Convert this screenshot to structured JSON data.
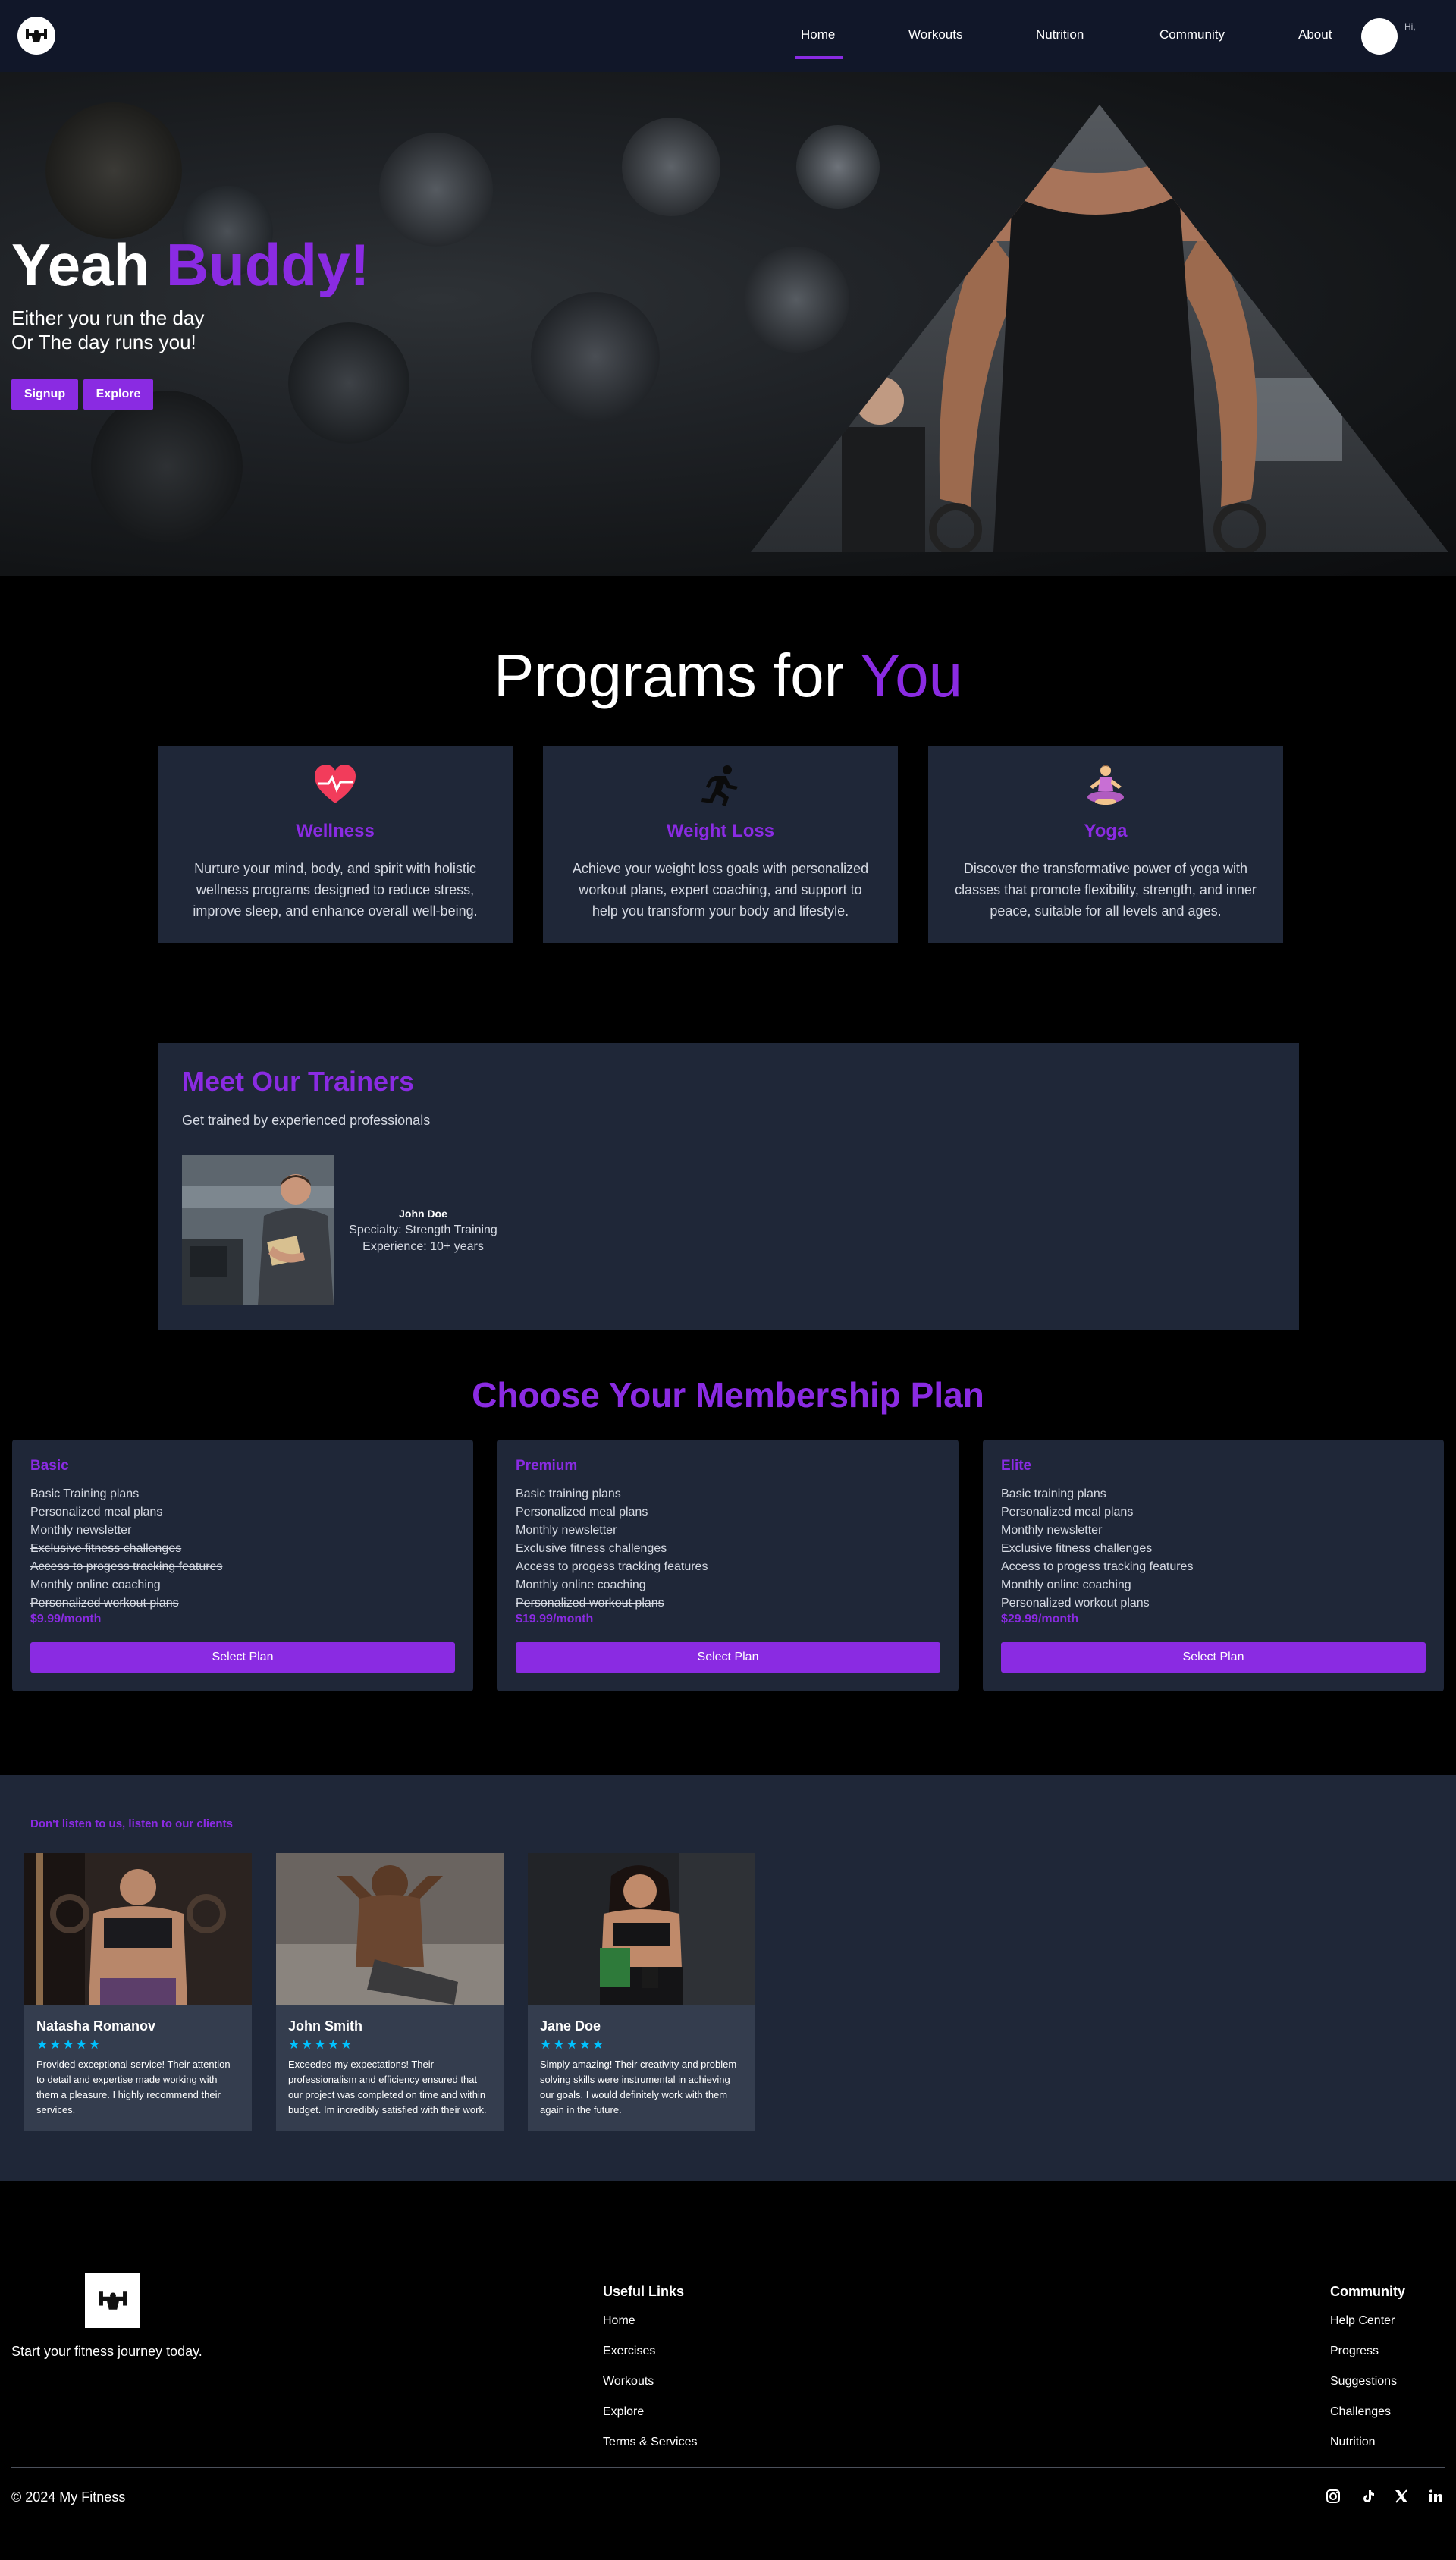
{
  "nav": {
    "items": [
      {
        "label": "Home"
      },
      {
        "label": "Workouts"
      },
      {
        "label": "Nutrition"
      },
      {
        "label": "Community"
      },
      {
        "label": "About"
      }
    ],
    "user_greeting": "Hi,"
  },
  "hero": {
    "title_prefix": "Yeah",
    "title_accent": "Buddy!",
    "subtitle_line1": "Either you run the day",
    "subtitle_line2": "Or The day runs you!",
    "signup_label": "Signup",
    "explore_label": "Explore"
  },
  "programs": {
    "title_prefix": "Programs for",
    "title_accent": "You",
    "cards": [
      {
        "icon": "heart-pulse-icon",
        "title": "Wellness",
        "desc": "Nurture your mind, body, and spirit with holistic wellness programs designed to reduce stress, improve sleep, and enhance overall well-being."
      },
      {
        "icon": "running-person-icon",
        "title": "Weight Loss",
        "desc": "Achieve your weight loss goals with personalized workout plans, expert coaching, and support to help you transform your body and lifestyle."
      },
      {
        "icon": "yoga-person-icon",
        "title": "Yoga",
        "desc": "Discover the transformative power of yoga with classes that promote flexibility, strength, and inner peace, suitable for all levels and ages."
      }
    ]
  },
  "trainers": {
    "title": "Meet Our Trainers",
    "subtitle": "Get trained by experienced professionals",
    "trainer": {
      "name": "John Doe",
      "specialty": "Specialty: Strength Training",
      "experience": "Experience: 10+ years"
    }
  },
  "membership": {
    "title": "Choose Your Membership Plan",
    "plans": [
      {
        "name": "Basic",
        "features": [
          {
            "text": "Basic Training plans",
            "included": true
          },
          {
            "text": "Personalized meal plans",
            "included": true
          },
          {
            "text": "Monthly newsletter",
            "included": true
          },
          {
            "text": "Exclusive fitness challenges",
            "included": false
          },
          {
            "text": "Access to progess tracking features",
            "included": false
          },
          {
            "text": "Monthly online coaching",
            "included": false
          },
          {
            "text": "Personalized workout plans",
            "included": false
          }
        ],
        "price": "$9.99/month",
        "button": "Select Plan"
      },
      {
        "name": "Premium",
        "features": [
          {
            "text": "Basic training plans",
            "included": true
          },
          {
            "text": "Personalized meal plans",
            "included": true
          },
          {
            "text": "Monthly newsletter",
            "included": true
          },
          {
            "text": "Exclusive fitness challenges",
            "included": true
          },
          {
            "text": "Access to progess tracking features",
            "included": true
          },
          {
            "text": "Monthly online coaching",
            "included": false
          },
          {
            "text": "Personalized workout plans",
            "included": false
          }
        ],
        "price": "$19.99/month",
        "button": "Select Plan"
      },
      {
        "name": "Elite",
        "features": [
          {
            "text": "Basic training plans",
            "included": true
          },
          {
            "text": "Personalized meal plans",
            "included": true
          },
          {
            "text": "Monthly newsletter",
            "included": true
          },
          {
            "text": "Exclusive fitness challenges",
            "included": true
          },
          {
            "text": "Access to progess tracking features",
            "included": true
          },
          {
            "text": "Monthly online coaching",
            "included": true
          },
          {
            "text": "Personalized workout plans",
            "included": true
          }
        ],
        "price": "$29.99/month",
        "button": "Select Plan"
      }
    ]
  },
  "testimonials": {
    "heading": "Don't listen to us, listen to our clients",
    "items": [
      {
        "name": "Natasha Romanov",
        "stars": "★★★★★",
        "text": "Provided exceptional service! Their attention to detail and expertise made working with them a pleasure. I highly recommend their services."
      },
      {
        "name": "John Smith",
        "stars": "★★★★★",
        "text": "Exceeded my expectations! Their professionalism and efficiency ensured that our project was completed on time and within budget. Im incredibly satisfied with their work."
      },
      {
        "name": "Jane Doe",
        "stars": "★★★★★",
        "text": "Simply amazing! Their creativity and problem-solving skills were instrumental in achieving our goals. I would definitely work with them again in the future."
      }
    ]
  },
  "footer": {
    "tagline": "Start your fitness journey today.",
    "useful_links": {
      "title": "Useful Links",
      "links": [
        "Home",
        "Exercises",
        "Workouts",
        "Explore",
        "Terms & Services"
      ]
    },
    "community": {
      "title": "Community",
      "links": [
        "Help Center",
        "Progress",
        "Suggestions",
        "Challenges",
        "Nutrition"
      ]
    },
    "copyright": "© 2024 My Fitness",
    "social": [
      "instagram-icon",
      "tiktok-icon",
      "x-icon",
      "linkedin-icon"
    ]
  },
  "colors": {
    "accent": "#8a2be2",
    "nav_bg": "#111729",
    "card_bg": "#1f2738",
    "stars": "#00c2ff"
  }
}
